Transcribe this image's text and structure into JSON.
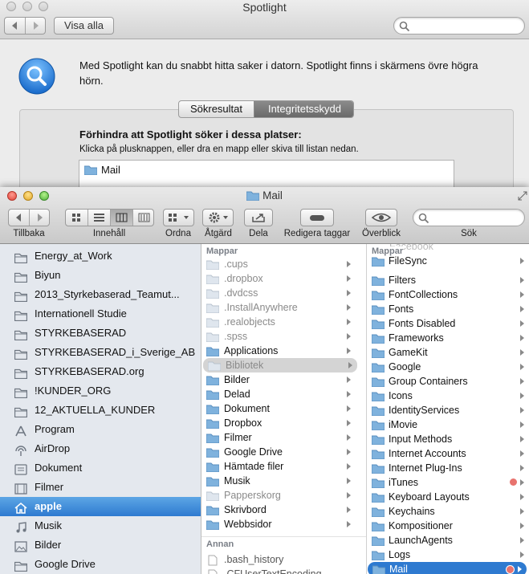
{
  "spotlight": {
    "title": "Spotlight",
    "show_all": "Visa alla",
    "description": "Med Spotlight kan du snabbt hitta saker i datorn. Spotlight finns i skärmens övre högra hörn.",
    "tabs": [
      {
        "label": "Sökresultat",
        "selected": false
      },
      {
        "label": "Integritetsskydd",
        "selected": true
      }
    ],
    "prevent_heading": "Förhindra att Spotlight söker i dessa platser:",
    "prevent_help": "Klicka på plusknappen, eller dra en mapp eller skiva till listan nedan.",
    "excluded": [
      "Mail"
    ]
  },
  "finder": {
    "title": "Mail",
    "toolbar": {
      "back_label": "Tillbaka",
      "view_label": "Innehåll",
      "arrange_label": "Ordna",
      "action_label": "Åtgärd",
      "share_label": "Dela",
      "tags_label": "Redigera taggar",
      "quicklook_label": "Överblick",
      "search_label": "Sök"
    },
    "sidebar": [
      {
        "label": "Energy_at_Work",
        "icon": "folder-icon"
      },
      {
        "label": "Biyun",
        "icon": "folder-icon"
      },
      {
        "label": "2013_Styrkebaserad_Teamut...",
        "icon": "folder-icon"
      },
      {
        "label": "Internationell Studie",
        "icon": "folder-icon"
      },
      {
        "label": "STYRKEBASERAD",
        "icon": "folder-icon"
      },
      {
        "label": "STYRKEBASERAD_i_Sverige_AB",
        "icon": "folder-icon"
      },
      {
        "label": "STYRKEBASERAD.org",
        "icon": "folder-icon"
      },
      {
        "label": "!KUNDER_ORG",
        "icon": "folder-icon"
      },
      {
        "label": "12_AKTUELLA_KUNDER",
        "icon": "folder-icon"
      },
      {
        "label": "Program",
        "icon": "applications-icon"
      },
      {
        "label": "AirDrop",
        "icon": "airdrop-icon"
      },
      {
        "label": "Dokument",
        "icon": "documents-icon"
      },
      {
        "label": "Filmer",
        "icon": "movies-icon"
      },
      {
        "label": "apple",
        "icon": "home-icon",
        "selected": true
      },
      {
        "label": "Musik",
        "icon": "music-icon"
      },
      {
        "label": "Bilder",
        "icon": "pictures-icon"
      },
      {
        "label": "Google Drive",
        "icon": "folder-icon"
      }
    ],
    "col1": {
      "header": "Mappar",
      "items": [
        {
          "label": ".cups",
          "dim": true
        },
        {
          "label": ".dropbox",
          "dim": true
        },
        {
          "label": ".dvdcss",
          "dim": true
        },
        {
          "label": ".InstallAnywhere",
          "dim": true
        },
        {
          "label": ".realobjects",
          "dim": true
        },
        {
          "label": ".spss",
          "dim": true
        },
        {
          "label": "Applications"
        },
        {
          "label": "Bibliotek",
          "dim": true,
          "selected": true
        },
        {
          "label": "Bilder"
        },
        {
          "label": "Delad"
        },
        {
          "label": "Dokument"
        },
        {
          "label": "Dropbox"
        },
        {
          "label": "Filmer"
        },
        {
          "label": "Google Drive"
        },
        {
          "label": "Hämtade filer"
        },
        {
          "label": "Musik"
        },
        {
          "label": "Papperskorg",
          "dim": true
        },
        {
          "label": "Skrivbord"
        },
        {
          "label": "Webbsidor"
        }
      ],
      "header2": "Annan",
      "other": [
        ".bash_history",
        ".CFUserTextEncoding"
      ]
    },
    "col2": {
      "header": "Mappar",
      "ghost": "Facebook",
      "items": [
        {
          "label": "FileSync"
        },
        {
          "label": "Filters"
        },
        {
          "label": "FontCollections"
        },
        {
          "label": "Fonts"
        },
        {
          "label": "Fonts Disabled"
        },
        {
          "label": "Frameworks"
        },
        {
          "label": "GameKit"
        },
        {
          "label": "Google"
        },
        {
          "label": "Group Containers"
        },
        {
          "label": "Icons"
        },
        {
          "label": "IdentityServices"
        },
        {
          "label": "iMovie"
        },
        {
          "label": "Input Methods"
        },
        {
          "label": "Internet Accounts"
        },
        {
          "label": "Internet Plug-Ins"
        },
        {
          "label": "iTunes",
          "tag": "#e8736e"
        },
        {
          "label": "Keyboard Layouts"
        },
        {
          "label": "Keychains"
        },
        {
          "label": "Kompositioner"
        },
        {
          "label": "LaunchAgents"
        },
        {
          "label": "Logs"
        },
        {
          "label": "Mail",
          "selected": true,
          "tag": "#e8736e"
        }
      ]
    },
    "colors": {
      "selection": "#2e7ad0",
      "folder": "#7fb2dd",
      "sidebar_bg": "#e4e8ee"
    }
  }
}
